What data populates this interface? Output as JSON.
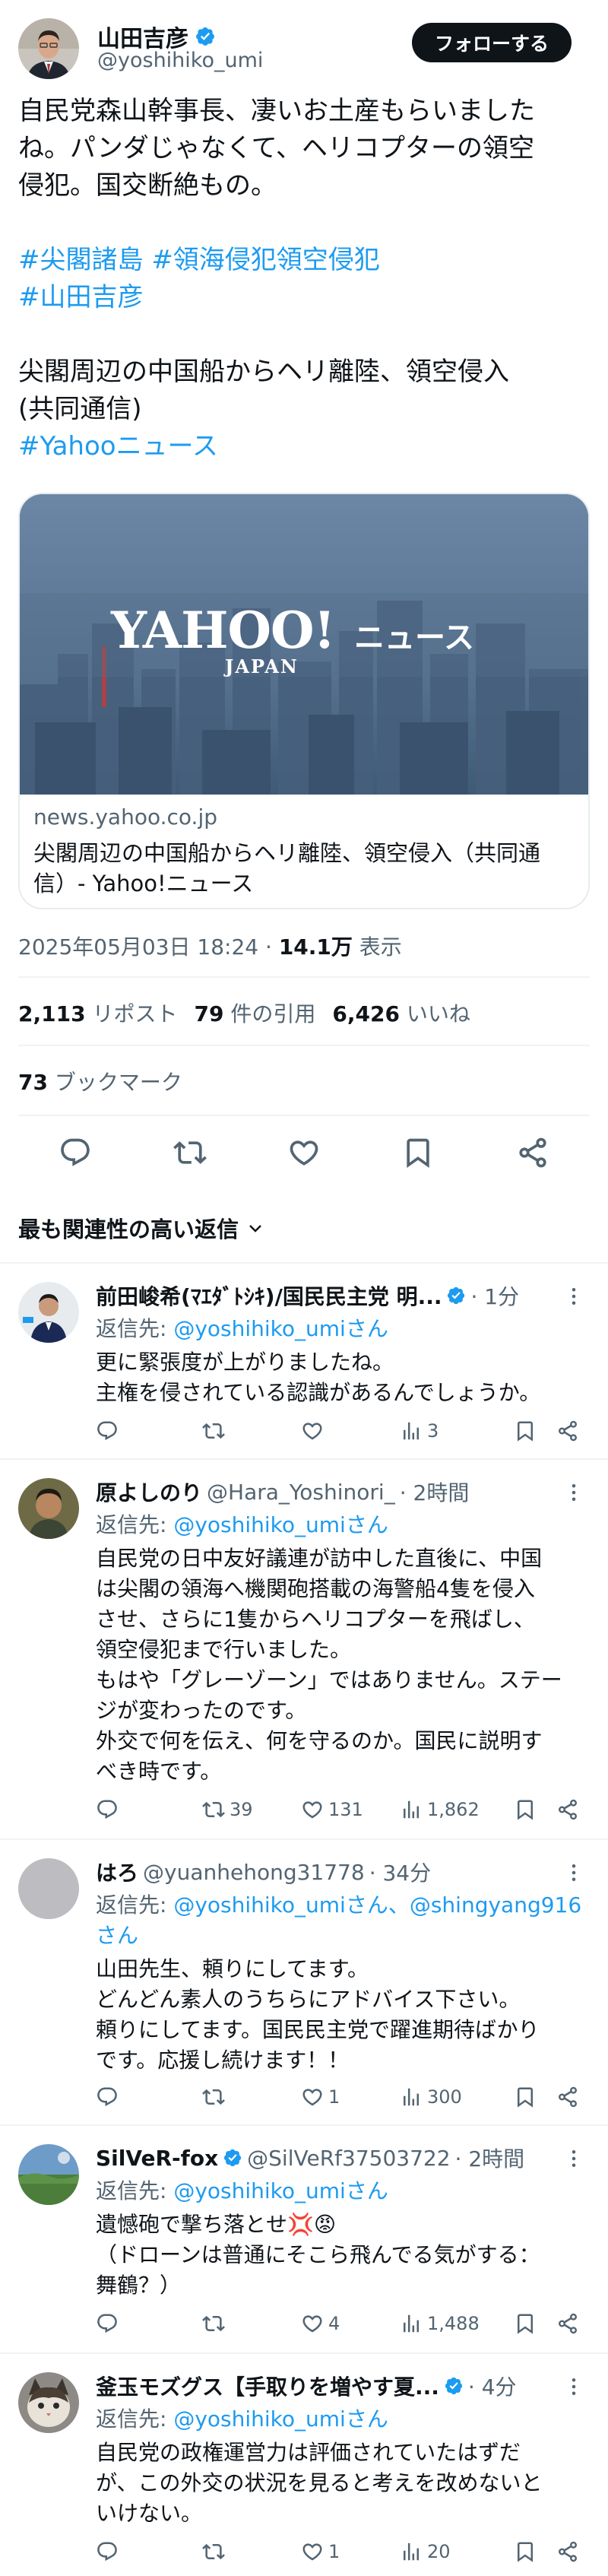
{
  "tweet": {
    "name": "山田吉彦",
    "handle": "@yoshihiko_umi",
    "follow_label": "フォローする",
    "text_line1": "自民党森山幹事長、凄いお土産もらいました",
    "text_line2": "ね。パンダじゃなくて、ヘリコプターの領空",
    "text_line3": "侵犯。国交断絶もの。",
    "tag1": "#尖閣諸島",
    "tag2": "#領海侵犯領空侵犯",
    "tag3": "#山田吉彦",
    "text_line4": "尖閣周辺の中国船からヘリ離陸、領空侵入",
    "text_line5": "(共同通信)",
    "tag4": "#Yahooニュース"
  },
  "card": {
    "logo_main": "YAHOO!",
    "logo_sub": "JAPAN",
    "logo_news": "ニュース",
    "domain": "news.yahoo.co.jp",
    "title_line1": "尖閣周辺の中国船からヘリ離陸、領空侵入（共同通",
    "title_line2": "信）- Yahoo!ニュース"
  },
  "meta": {
    "date": "2025年05月03日 18:24",
    "sep": " · ",
    "views_count": "14.1万",
    "views_label": " 表示"
  },
  "stats": {
    "reposts_count": "2,113",
    "reposts_label": " リポスト",
    "quotes_count": "79",
    "quotes_label": " 件の引用",
    "likes_count": "6,426",
    "likes_label": " いいね",
    "bookmarks_count": "73",
    "bookmarks_label": " ブックマーク"
  },
  "sort": {
    "label": "最も関連性の高い返信"
  },
  "replies": [
    {
      "name": "前田峻希(ﾏｴﾀﾞﾄｼｷ)/国民民主党 明...",
      "handle": "",
      "time": "· 1分",
      "reply_to_prefix": "返信先: ",
      "reply_to": "@yoshihiko_umiさん",
      "lines": [
        "更に緊張度が上がりましたね。",
        "主権を侵されている認識があるんでしょうか。"
      ],
      "retweets": "",
      "likes": "",
      "views": "3"
    },
    {
      "name": "原よしのり",
      "handle": "@Hara_Yoshinori_",
      "time": "· 2時間",
      "reply_to_prefix": "返信先: ",
      "reply_to": "@yoshihiko_umiさん",
      "lines": [
        "自民党の日中友好議連が訪中した直後に、中国",
        "は尖閣の領海へ機関砲搭載の海警船4隻を侵入",
        "させ、さらに1隻からヘリコプターを飛ばし、",
        "領空侵犯まで行いました。",
        "もはや「グレーゾーン」ではありません。ステー",
        "ジが変わったのです。",
        "外交で何を伝え、何を守るのか。国民に説明す",
        "べき時です。"
      ],
      "retweets": "39",
      "likes": "131",
      "views": "1,862"
    },
    {
      "name": "はろ",
      "handle": "@yuanhehong31778",
      "time": "· 34分",
      "reply_to_prefix": "返信先: ",
      "reply_to": "@yoshihiko_umiさん、@shingyang916",
      "reply_to2": "さん",
      "lines": [
        "山田先生、頼りにしてます。",
        "どんどん素人のうちらにアドバイス下さい。",
        "頼りにしてます。国民民主党で躍進期待ばかり",
        "です。応援し続けます！！"
      ],
      "retweets": "",
      "likes": "1",
      "views": "300"
    },
    {
      "name": "SilVeR-fox",
      "handle": "@SilVeRf37503722",
      "time": "· 2時間",
      "reply_to_prefix": "返信先: ",
      "reply_to": "@yoshihiko_umiさん",
      "lines": [
        "遺憾砲で撃ち落とせ💢😡",
        "（ドローンは普通にそこら飛んでる気がする：",
        "舞鶴？）"
      ],
      "retweets": "",
      "likes": "4",
      "views": "1,488"
    },
    {
      "name": "釜玉モズグス【手取りを増やす夏...",
      "handle": "",
      "time": "· 4分",
      "reply_to_prefix": "返信先: ",
      "reply_to": "@yoshihiko_umiさん",
      "lines": [
        "自民党の政権運営力は評価されていたはずだ",
        "が、この外交の状況を見ると考えを改めないと",
        "いけない。"
      ],
      "retweets": "",
      "likes": "1",
      "views": "20"
    }
  ],
  "colors": {
    "accent": "#1d9bf0",
    "secondary_text": "#536471",
    "text": "#0f1419",
    "verified": "#1d9bf0"
  },
  "icons": [
    "verified-badge-icon",
    "reply-icon",
    "retweet-icon",
    "like-icon",
    "bookmark-icon",
    "share-icon",
    "views-icon",
    "more-icon",
    "chevron-down-icon"
  ]
}
